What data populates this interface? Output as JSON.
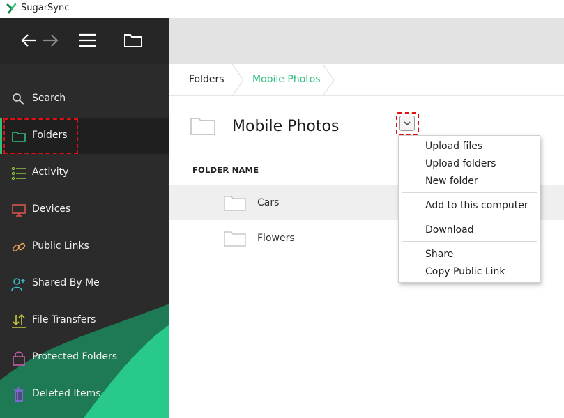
{
  "window": {
    "title": "SugarSync"
  },
  "colors": {
    "accent": "#2fbf7f",
    "sidebar_bg": "#2b2b2b",
    "highlight": "#e01010"
  },
  "toolbar": {
    "back_icon": "arrow-left-icon",
    "forward_icon": "arrow-right-icon",
    "menu_icon": "hamburger-menu-icon",
    "folder_icon": "folder-icon"
  },
  "sidebar": {
    "items": [
      {
        "label": "Search",
        "icon": "search-icon",
        "color": "#cfcfcf"
      },
      {
        "label": "Folders",
        "icon": "folder-icon",
        "color": "#2fbf7f",
        "active": true
      },
      {
        "label": "Activity",
        "icon": "activity-list-icon",
        "color": "#8cc63f"
      },
      {
        "label": "Devices",
        "icon": "monitor-icon",
        "color": "#d9534f"
      },
      {
        "label": "Public Links",
        "icon": "link-icon",
        "color": "#e8a25a"
      },
      {
        "label": "Shared By Me",
        "icon": "share-user-icon",
        "color": "#3fb8c8"
      },
      {
        "label": "File Transfers",
        "icon": "transfer-arrows-icon",
        "color": "#c8c83f"
      },
      {
        "label": "Protected Folders",
        "icon": "lock-icon",
        "color": "#c45aa8"
      },
      {
        "label": "Deleted Items",
        "icon": "trash-icon",
        "color": "#7a6ad0"
      }
    ]
  },
  "breadcrumb": {
    "items": [
      "Folders",
      "Mobile Photos"
    ]
  },
  "main": {
    "title": "Mobile Photos",
    "column_header": "FOLDER NAME",
    "folders": [
      {
        "name": "Cars",
        "selected": true
      },
      {
        "name": "Flowers",
        "selected": false
      }
    ]
  },
  "context_menu": {
    "groups": [
      [
        "Upload files",
        "Upload folders",
        "New folder"
      ],
      [
        "Add to this computer"
      ],
      [
        "Download"
      ],
      [
        "Share",
        "Copy Public Link"
      ]
    ]
  }
}
